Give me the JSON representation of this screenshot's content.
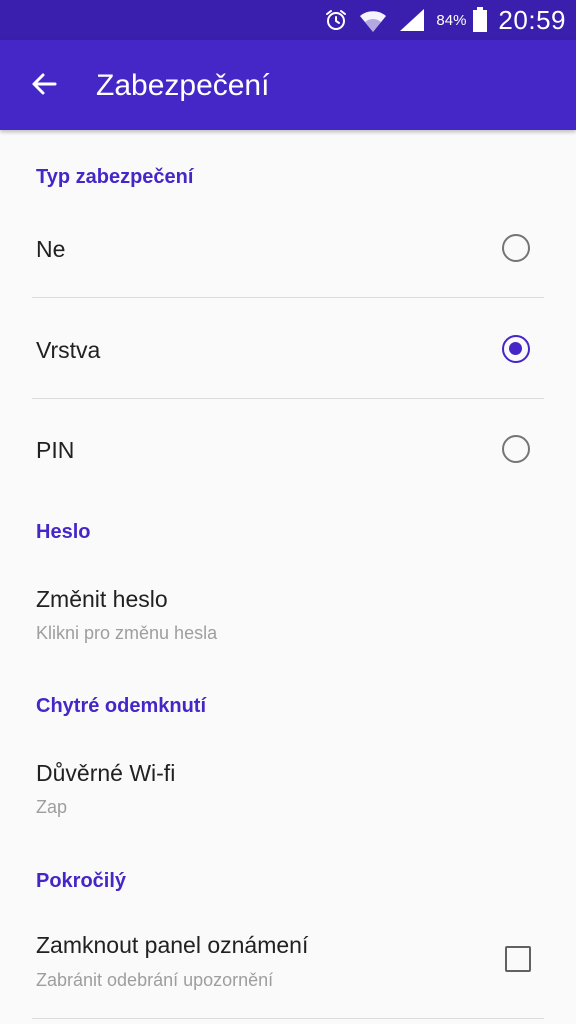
{
  "status_bar": {
    "battery_percent": "84%",
    "time": "20:59",
    "icons": [
      "alarm-icon",
      "wifi-icon",
      "signal-icon",
      "battery-icon"
    ]
  },
  "app_bar": {
    "title": "Zabezpečení",
    "back_icon": "arrow-left-icon"
  },
  "sections": {
    "security_type": {
      "header": "Typ zabezpečení",
      "options": [
        {
          "label": "Ne",
          "selected": false
        },
        {
          "label": "Vrstva",
          "selected": true
        },
        {
          "label": "PIN",
          "selected": false
        }
      ]
    },
    "password": {
      "header": "Heslo",
      "item": {
        "title": "Změnit heslo",
        "subtitle": "Klikni pro změnu hesla"
      }
    },
    "smart_unlock": {
      "header": "Chytré odemknutí",
      "item": {
        "title": "Důvěrné Wi-fi",
        "subtitle": "Zap"
      }
    },
    "advanced": {
      "header": "Pokročilý",
      "item": {
        "title": "Zamknout panel oznámení",
        "subtitle": "Zabránit odebrání upozornění",
        "checked": false
      }
    }
  },
  "colors": {
    "status_bar": "#3a1fae",
    "app_bar": "#4527c8",
    "accent": "#4527c8",
    "text_primary": "#212121",
    "text_secondary": "#9e9e9e"
  }
}
